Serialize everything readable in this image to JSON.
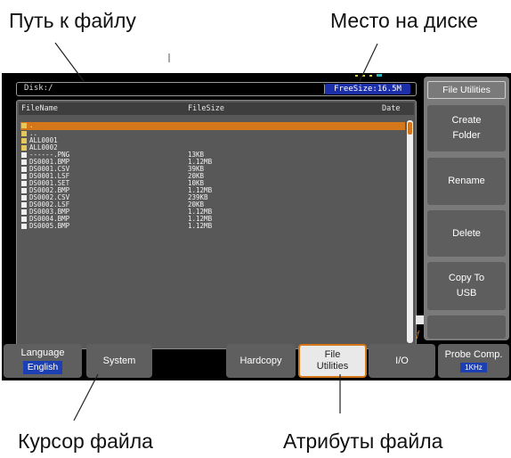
{
  "callouts": {
    "path": "Путь к файлу",
    "disk_space": "Место на диске",
    "cursor": "Курсор файла",
    "attributes": "Атрибуты файла"
  },
  "screen": {
    "path": "Disk:/",
    "free_size": "FreeSize:16.5M",
    "headers": {
      "name": "FileName",
      "size": "FileSize",
      "date": "Date"
    },
    "files": [
      {
        "icon": "folder-icon",
        "name": ".",
        "size": "",
        "selected": true
      },
      {
        "icon": "folder-icon",
        "name": "..",
        "size": ""
      },
      {
        "icon": "folder-icon",
        "name": "ALL0001",
        "size": ""
      },
      {
        "icon": "folder-icon",
        "name": "ALL0002",
        "size": ""
      },
      {
        "icon": "file-icon",
        "name": "------.PNG",
        "size": "13KB"
      },
      {
        "icon": "file-icon",
        "name": "DS0001.BMP",
        "size": "1.12MB"
      },
      {
        "icon": "file-icon",
        "name": "DS0001.CSV",
        "size": "39KB"
      },
      {
        "icon": "file-icon",
        "name": "DS0001.LSF",
        "size": "20KB"
      },
      {
        "icon": "file-icon",
        "name": "DS0001.SET",
        "size": "10KB"
      },
      {
        "icon": "file-icon",
        "name": "DS0002.BMP",
        "size": "1.12MB"
      },
      {
        "icon": "file-icon",
        "name": "DS0002.CSV",
        "size": "239KB"
      },
      {
        "icon": "file-icon",
        "name": "DS0002.LSF",
        "size": "20KB"
      },
      {
        "icon": "file-icon",
        "name": "DS0003.BMP",
        "size": "1.12MB"
      },
      {
        "icon": "file-icon",
        "name": "DS0004.BMP",
        "size": "1.12MB"
      },
      {
        "icon": "file-icon",
        "name": "DS0005.BMP",
        "size": "1.12MB"
      }
    ],
    "side_menu": {
      "title": "File Utilities",
      "create_folder": "Create\nFolder",
      "rename": "Rename",
      "delete": "Delete",
      "copy_to_usb": "Copy To\nUSB"
    },
    "bottom": {
      "language": "Language",
      "language_value": "English",
      "system": "System",
      "hardcopy": "Hardcopy",
      "file_utilities": "File\nUtilities",
      "io": "I/O",
      "probe_comp": "Probe Comp.",
      "probe_comp_value": "1KHz"
    }
  },
  "colors": {
    "accent": "#d4771a",
    "value_blue": "#1c3fb3",
    "screen": "#000000"
  }
}
